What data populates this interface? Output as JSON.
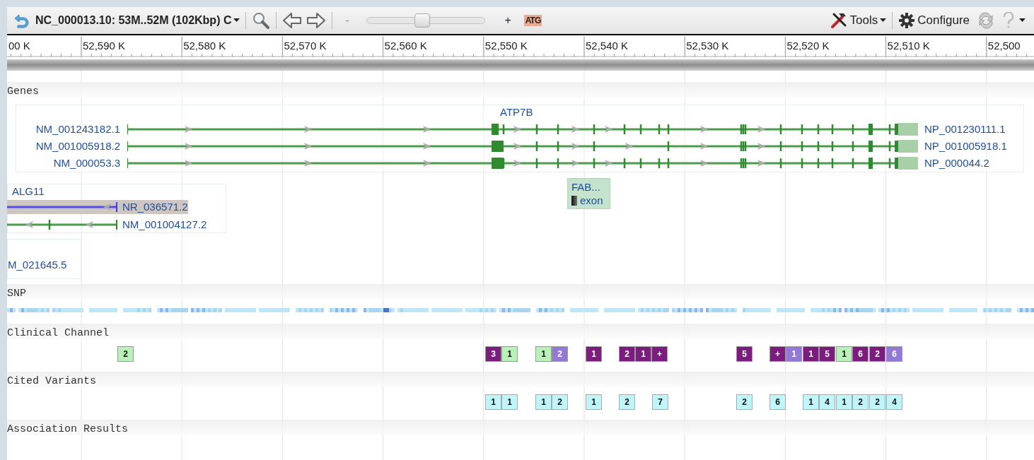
{
  "toolbar": {
    "location": "NC_000013.10: 53M..52M (102Kbp) C",
    "zoom_out": "-",
    "zoom_in": "+",
    "zoom": {
      "level": 0.47
    },
    "sequence_button": "ATG",
    "tools": "Tools",
    "configure": "Configure"
  },
  "ruler": {
    "ticks": [
      "00 K",
      "52,590 K",
      "52,580 K",
      "52,570 K",
      "52,560 K",
      "52,550 K",
      "52,540 K",
      "52,530 K",
      "52,520 K",
      "52,510 K",
      "52,500"
    ]
  },
  "genes": {
    "header": "Genes",
    "groups": [
      {
        "name": "ATP7B",
        "transcripts": [
          {
            "label": "NM_001243182.1",
            "protein": "NP_001230111.1",
            "kind": "coding"
          },
          {
            "label": "NM_001005918.2",
            "protein": "NP_001005918.1",
            "kind": "coding"
          },
          {
            "label": "NM_000053.3",
            "protein": "NP_000044.2",
            "kind": "coding"
          }
        ]
      },
      {
        "name": "ALG11",
        "transcripts": [
          {
            "label": "NR_036571.2",
            "kind": "noncoding",
            "highlighted": true
          },
          {
            "label": "NM_001004127.2",
            "kind": "coding",
            "highlighted": false
          }
        ]
      },
      {
        "transcripts": [
          {
            "label": "M_021645.5"
          }
        ]
      }
    ],
    "feature": {
      "label": "FAB...",
      "legend": "exon"
    }
  },
  "snp": {
    "header": "SNP"
  },
  "clinical": {
    "header": "Clinical Channel",
    "boxes": [
      {
        "text": "2",
        "color": "#b9f2b9"
      },
      {
        "text": "3",
        "color": "#7b1c7e"
      },
      {
        "text": "1",
        "color": "#b9f2b9"
      },
      {
        "text": "1",
        "color": "#b9f2b9"
      },
      {
        "text": "2",
        "color": "#9378d8"
      },
      {
        "text": "1",
        "color": "#7b1c7e"
      },
      {
        "text": "2",
        "color": "#7b1c7e"
      },
      {
        "text": "1",
        "color": "#7b1c7e"
      },
      {
        "text": "+",
        "color": "#7b1c7e"
      },
      {
        "text": "5",
        "color": "#7b1c7e"
      },
      {
        "text": "+",
        "color": "#7b1c7e"
      },
      {
        "text": "1",
        "color": "#9378d8"
      },
      {
        "text": "1",
        "color": "#7b1c7e"
      },
      {
        "text": "5",
        "color": "#7b1c7e"
      },
      {
        "text": "1",
        "color": "#b9f2b9"
      },
      {
        "text": "6",
        "color": "#7b1c7e"
      },
      {
        "text": "2",
        "color": "#7b1c7e"
      },
      {
        "text": "6",
        "color": "#9378d8"
      }
    ]
  },
  "cited": {
    "header": "Cited Variants",
    "boxes": [
      "1",
      "1",
      "1",
      "2",
      "1",
      "2",
      "7",
      "2",
      "6",
      "1",
      "4",
      "1",
      "2",
      "2",
      "4"
    ]
  },
  "association": {
    "header": "Association Results"
  }
}
